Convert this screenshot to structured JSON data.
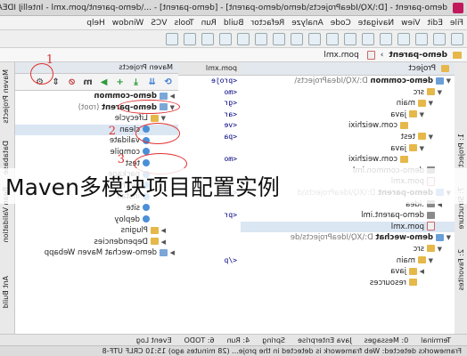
{
  "window": {
    "title": "demo-parent - [D:\\XQ\\IdeaProjects\\demo\\demo-parent] - [demo-parent] - ...\\demo-parent\\pom.xml - IntelliJ IDEA 2016.1"
  },
  "menu": [
    "File",
    "Edit",
    "View",
    "Navigate",
    "Code",
    "Analyze",
    "Refactor",
    "Build",
    "Run",
    "Tools",
    "VCS",
    "Window",
    "Help"
  ],
  "breadcrumb": {
    "project": "demo-parent",
    "file": "pom.xml"
  },
  "left_strip": [
    "1: Project",
    "7: Structure",
    "2: Favorites"
  ],
  "right_strip": [
    "Maven Projects",
    "Database",
    "Bean Validation",
    "Ant Build"
  ],
  "project_panel": {
    "header": "Project",
    "rows": [
      {
        "indent": 0,
        "arrow": "▼",
        "icon": "mod",
        "text": "demo-common",
        "extra": " D:\\XQ\\IdeaProjects\\"
      },
      {
        "indent": 1,
        "arrow": "▼",
        "icon": "fold",
        "text": "src"
      },
      {
        "indent": 2,
        "arrow": "▼",
        "icon": "fold",
        "text": "main"
      },
      {
        "indent": 3,
        "arrow": "▼",
        "icon": "fold",
        "text": "java"
      },
      {
        "indent": 4,
        "arrow": "",
        "icon": "fold",
        "text": "com.weizhixi"
      },
      {
        "indent": 2,
        "arrow": "▼",
        "icon": "fold",
        "text": "test"
      },
      {
        "indent": 3,
        "arrow": "▼",
        "icon": "fold",
        "text": "java"
      },
      {
        "indent": 4,
        "arrow": "",
        "icon": "fold",
        "text": "com.weizhixi"
      },
      {
        "indent": 1,
        "arrow": "",
        "icon": "idea",
        "text": "demo-common.iml"
      },
      {
        "indent": 1,
        "arrow": "",
        "icon": "xml",
        "text": "pom.xml"
      },
      {
        "indent": 0,
        "arrow": "▼",
        "icon": "mod",
        "text": "demo-parent",
        "extra": " D:\\XQ\\IdeaProjects\\d"
      },
      {
        "indent": 1,
        "arrow": "▶",
        "icon": "idea",
        "text": ".idea"
      },
      {
        "indent": 1,
        "arrow": "",
        "icon": "idea",
        "text": "demo-parent.iml"
      },
      {
        "indent": 1,
        "arrow": "",
        "icon": "xml",
        "text": "pom.xml",
        "sel": true
      },
      {
        "indent": 0,
        "arrow": "▼",
        "icon": "mod",
        "text": "demo-wechat",
        "extra": " D:\\XQ\\IdeaProjects\\de"
      },
      {
        "indent": 1,
        "arrow": "▼",
        "icon": "fold",
        "text": "src"
      },
      {
        "indent": 2,
        "arrow": "▼",
        "icon": "fold",
        "text": "main"
      },
      {
        "indent": 3,
        "arrow": "▶",
        "icon": "fold",
        "text": "java"
      },
      {
        "indent": 3,
        "arrow": "",
        "icon": "fold",
        "text": "resources"
      }
    ]
  },
  "editor": {
    "tab": "pom.xml",
    "lines": [
      "<proje",
      "<mo",
      "<gr",
      "<ar",
      "<ve",
      "<pa",
      "",
      "<mo",
      "",
      "",
      "</m",
      "",
      "<pr",
      "",
      "",
      "",
      "</p",
      "",
      "",
      "",
      "",
      "",
      ""
    ]
  },
  "maven_panel": {
    "header": "Maven Projects",
    "rows": [
      {
        "indent": 0,
        "arrow": "▶",
        "icon": "mvfold",
        "text": "demo-common"
      },
      {
        "indent": 0,
        "arrow": "▼",
        "icon": "mvfold",
        "text": "demo-parent",
        "extra": " (root)"
      },
      {
        "indent": 1,
        "arrow": "▼",
        "icon": "fold",
        "text": "Lifecycle"
      },
      {
        "indent": 2,
        "arrow": "",
        "icon": "gear",
        "text": "clean",
        "sel": true
      },
      {
        "indent": 2,
        "arrow": "",
        "icon": "gear",
        "text": "validate"
      },
      {
        "indent": 2,
        "arrow": "",
        "icon": "gear",
        "text": "compile"
      },
      {
        "indent": 2,
        "arrow": "",
        "icon": "gear",
        "text": "test"
      },
      {
        "indent": 2,
        "arrow": "",
        "icon": "gear",
        "text": "package"
      },
      {
        "indent": 2,
        "arrow": "",
        "icon": "gear",
        "text": "verify"
      },
      {
        "indent": 2,
        "arrow": "",
        "icon": "gear",
        "text": "install"
      },
      {
        "indent": 2,
        "arrow": "",
        "icon": "gear",
        "text": "site"
      },
      {
        "indent": 2,
        "arrow": "",
        "icon": "gear",
        "text": "deploy"
      },
      {
        "indent": 1,
        "arrow": "▶",
        "icon": "fold",
        "text": "Plugins"
      },
      {
        "indent": 1,
        "arrow": "▶",
        "icon": "fold",
        "text": "Dependencies"
      },
      {
        "indent": 0,
        "arrow": "▶",
        "icon": "mvfold",
        "text": "demo-wechat Maven Webapp"
      }
    ],
    "annotations": [
      "1",
      "2",
      "3"
    ]
  },
  "bottom_tools": [
    "Terminal",
    "0: Messages",
    "Java Enterprise",
    "Spring",
    "4: Run",
    "6: TODO",
    "Event Log"
  ],
  "status": "Frameworks detected: Web framework is detected in the proje... (28 minutes ago)   15:10   CRLF   UTF-8",
  "caption": "Maven多模块项目配置实例"
}
